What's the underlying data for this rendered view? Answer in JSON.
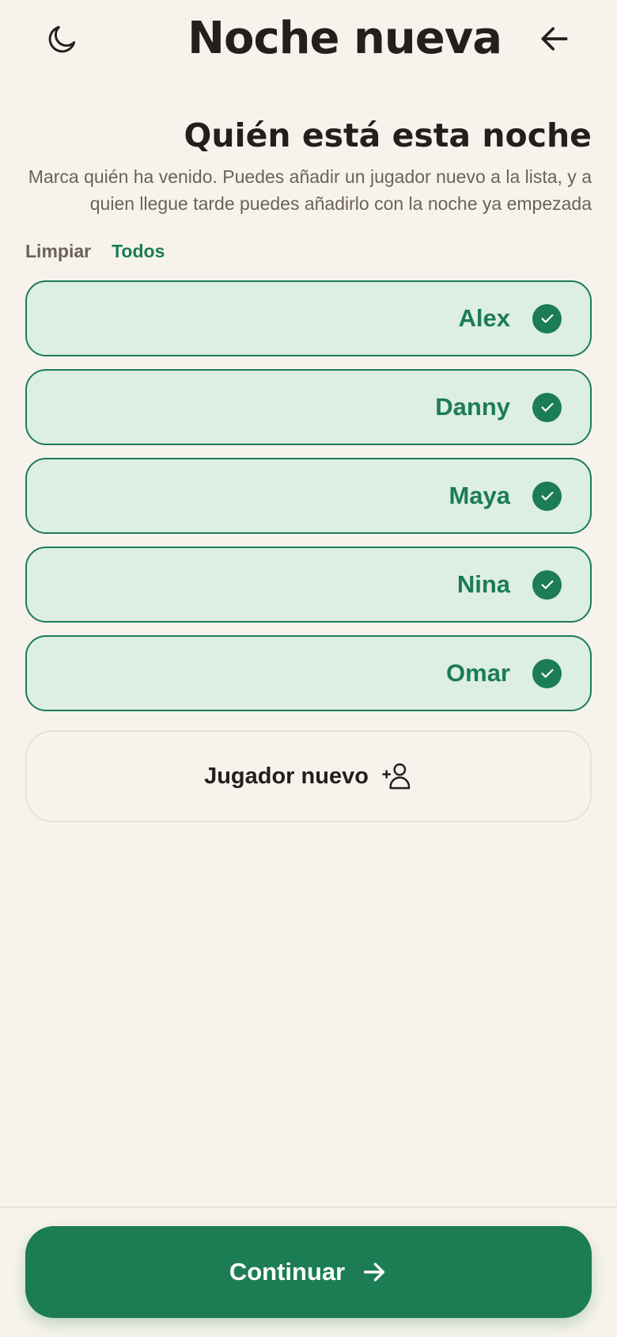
{
  "header": {
    "title": "Noche nueva",
    "theme_icon": "moon-icon",
    "back_icon": "arrow-left-icon"
  },
  "section": {
    "title": "Quién está esta noche",
    "description": "Marca quién ha venido. Puedes añadir un jugador nuevo a la lista, y a quien llegue tarde puedes añadirlo con la noche ya empezada"
  },
  "quick_actions": {
    "clear_label": "Limpiar",
    "all_label": "Todos"
  },
  "players": [
    {
      "name": "Alex",
      "selected": true
    },
    {
      "name": "Danny",
      "selected": true
    },
    {
      "name": "Maya",
      "selected": true
    },
    {
      "name": "Nina",
      "selected": true
    },
    {
      "name": "Omar",
      "selected": true
    }
  ],
  "add_player": {
    "label": "Jugador nuevo",
    "icon": "user-plus-icon"
  },
  "footer": {
    "continue_label": "Continuar",
    "continue_icon": "arrow-right-icon"
  },
  "colors": {
    "background": "#f7f3ec",
    "accent": "#1c7c54",
    "selected_fill": "#ddeee3",
    "text": "#241f1a",
    "muted_text": "#6b625a"
  }
}
